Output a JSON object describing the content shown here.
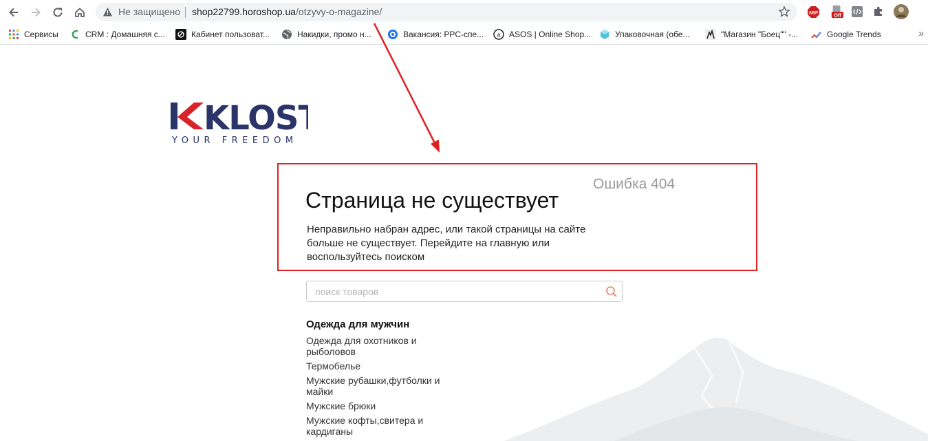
{
  "browser": {
    "security_text": "Не защищено",
    "url_host": "shop22799.horoshop.ua",
    "url_path": "/otzyvy-o-magazine/",
    "bookmarks": [
      {
        "label": "Сервисы",
        "icon": "apps-grid-icon"
      },
      {
        "label": "CRM : Домашняя с...",
        "icon": "crm-icon"
      },
      {
        "label": "Кабинет пользоват...",
        "icon": "cabinet-icon"
      },
      {
        "label": "Накидки, промо н...",
        "icon": "globe-icon"
      },
      {
        "label": "Вакансия: PPC-спе...",
        "icon": "target-icon"
      },
      {
        "label": "ASOS | Online Shop...",
        "icon": "asos-icon"
      },
      {
        "label": "Упаковочная (обе...",
        "icon": "package-icon"
      },
      {
        "label": "\"Магазин \"Боец\"\" -...",
        "icon": "fighter-icon"
      },
      {
        "label": "Google Trends",
        "icon": "trends-icon"
      }
    ],
    "bookmarks_more": "»",
    "extensions": [
      {
        "name": "adblock-icon",
        "label": "ABP"
      },
      {
        "name": "off-extension-icon",
        "label": "Off"
      }
    ],
    "colors": {
      "adblock": "#d11f1f",
      "omnibox": "#f1f3f4"
    }
  },
  "page": {
    "logo_text": "KLOST",
    "logo_sub": "YOUR FREEDOM",
    "error_code": "Ошибка 404",
    "error_title": "Страница не существует",
    "error_desc": "Неправильно набран адрес, или такой страницы на сайте больше не существует. Перейдите на главную или воспользуйтесь поиском",
    "search_placeholder": "поиск товаров",
    "category_title": "Одежда для мужчин",
    "categories": [
      "Одежда для охотников и рыболовов",
      "Термобелье",
      "Мужские рубашки,футболки и майки",
      "Мужские брюки",
      "Мужские кофты,свитера и кардиганы"
    ],
    "colors": {
      "brand_navy": "#2b3468",
      "brand_red": "#d8232a",
      "annotation": "#e02020",
      "search_icon": "#f07c5a"
    }
  }
}
